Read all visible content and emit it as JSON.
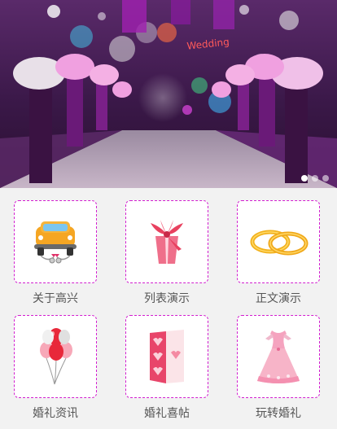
{
  "banner": {
    "watermark": "Wedding",
    "slide_count": 3,
    "active_slide": 1
  },
  "menu": {
    "items": [
      {
        "label": "关于高兴",
        "icon": "wedding-car-icon"
      },
      {
        "label": "列表演示",
        "icon": "gift-box-icon"
      },
      {
        "label": "正文演示",
        "icon": "wedding-rings-icon"
      },
      {
        "label": "婚礼资讯",
        "icon": "balloons-icon"
      },
      {
        "label": "婚礼喜帖",
        "icon": "invitation-card-icon"
      },
      {
        "label": "玩转婚礼",
        "icon": "wedding-dress-icon"
      }
    ]
  },
  "colors": {
    "tile_border": "#d21ecf",
    "label": "#555555",
    "page_background": "#f2f2f2"
  }
}
